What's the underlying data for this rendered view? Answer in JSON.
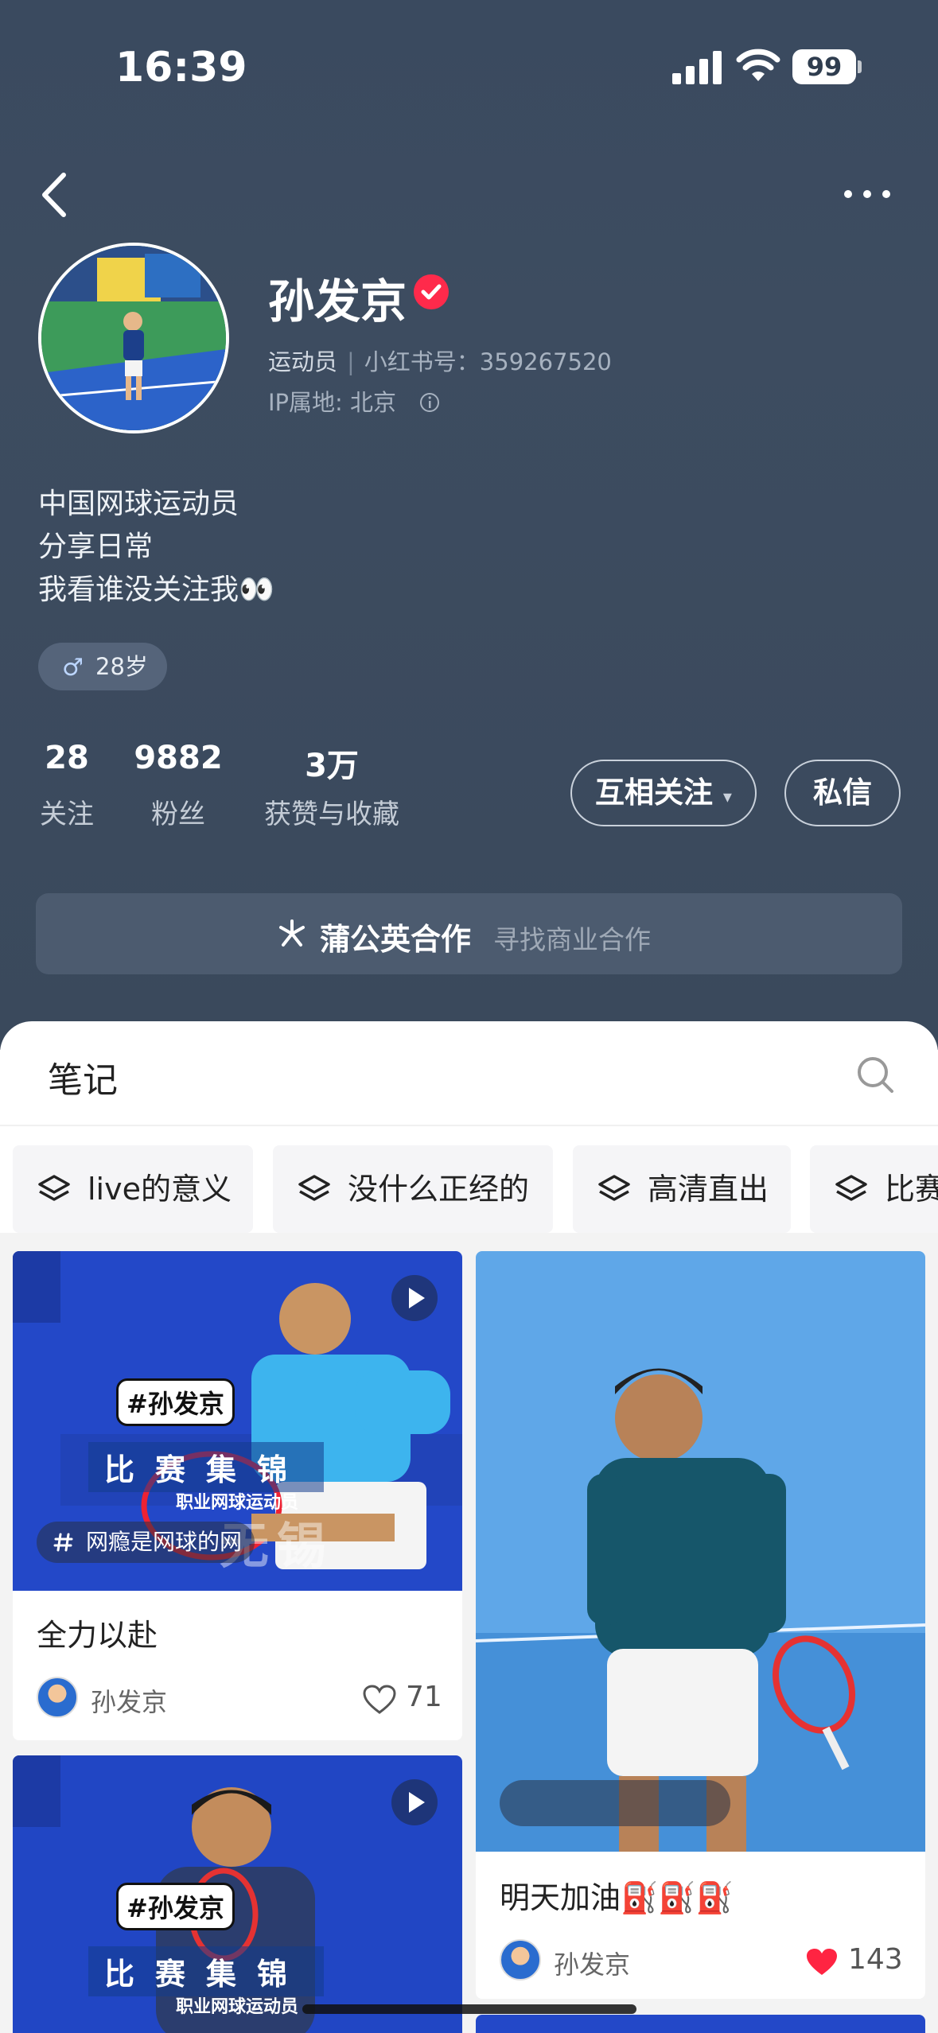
{
  "status_bar": {
    "time": "16:39",
    "battery": "99"
  },
  "profile": {
    "name": "孙发京",
    "role": "运动员",
    "red_id": "小红书号：359267520",
    "ip": "IP属地: 北京",
    "bio": [
      "中国网球运动员",
      "分享日常",
      "我看谁没关注我👀"
    ],
    "age_tag": "28岁"
  },
  "stats": [
    {
      "num": "28",
      "label": "关注"
    },
    {
      "num": "9882",
      "label": "粉丝"
    },
    {
      "num": "3万",
      "label": "获赞与收藏"
    }
  ],
  "buttons": {
    "follow": "互相关注",
    "follow_caret": "▾",
    "message": "私信"
  },
  "collab": {
    "title": "蒲公英合作",
    "subtitle": "寻找商业合作"
  },
  "notes": {
    "title": "笔记"
  },
  "collections": [
    "live的意义",
    "没什么正经的",
    "高清直出",
    "比赛"
  ],
  "feed": [
    {
      "title": "全力以赴",
      "author": "孙发京",
      "likes": "71",
      "tag": "网瘾是网球的网",
      "badge": "#孙发京",
      "overlay_main": "比赛集锦",
      "overlay_sub": "职业网球运动员",
      "overlay_bg": "无锡",
      "liked": false
    },
    {
      "title": "明天加油⛽⛽⛽",
      "author": "孙发京",
      "likes": "143",
      "liked": true
    },
    {
      "badge": "#孙发京",
      "overlay_main": "比赛集锦",
      "overlay_sub": "职业网球运动员"
    }
  ],
  "colors": {
    "accent_red": "#ff2442",
    "header_bg": "#3a4a5f"
  }
}
